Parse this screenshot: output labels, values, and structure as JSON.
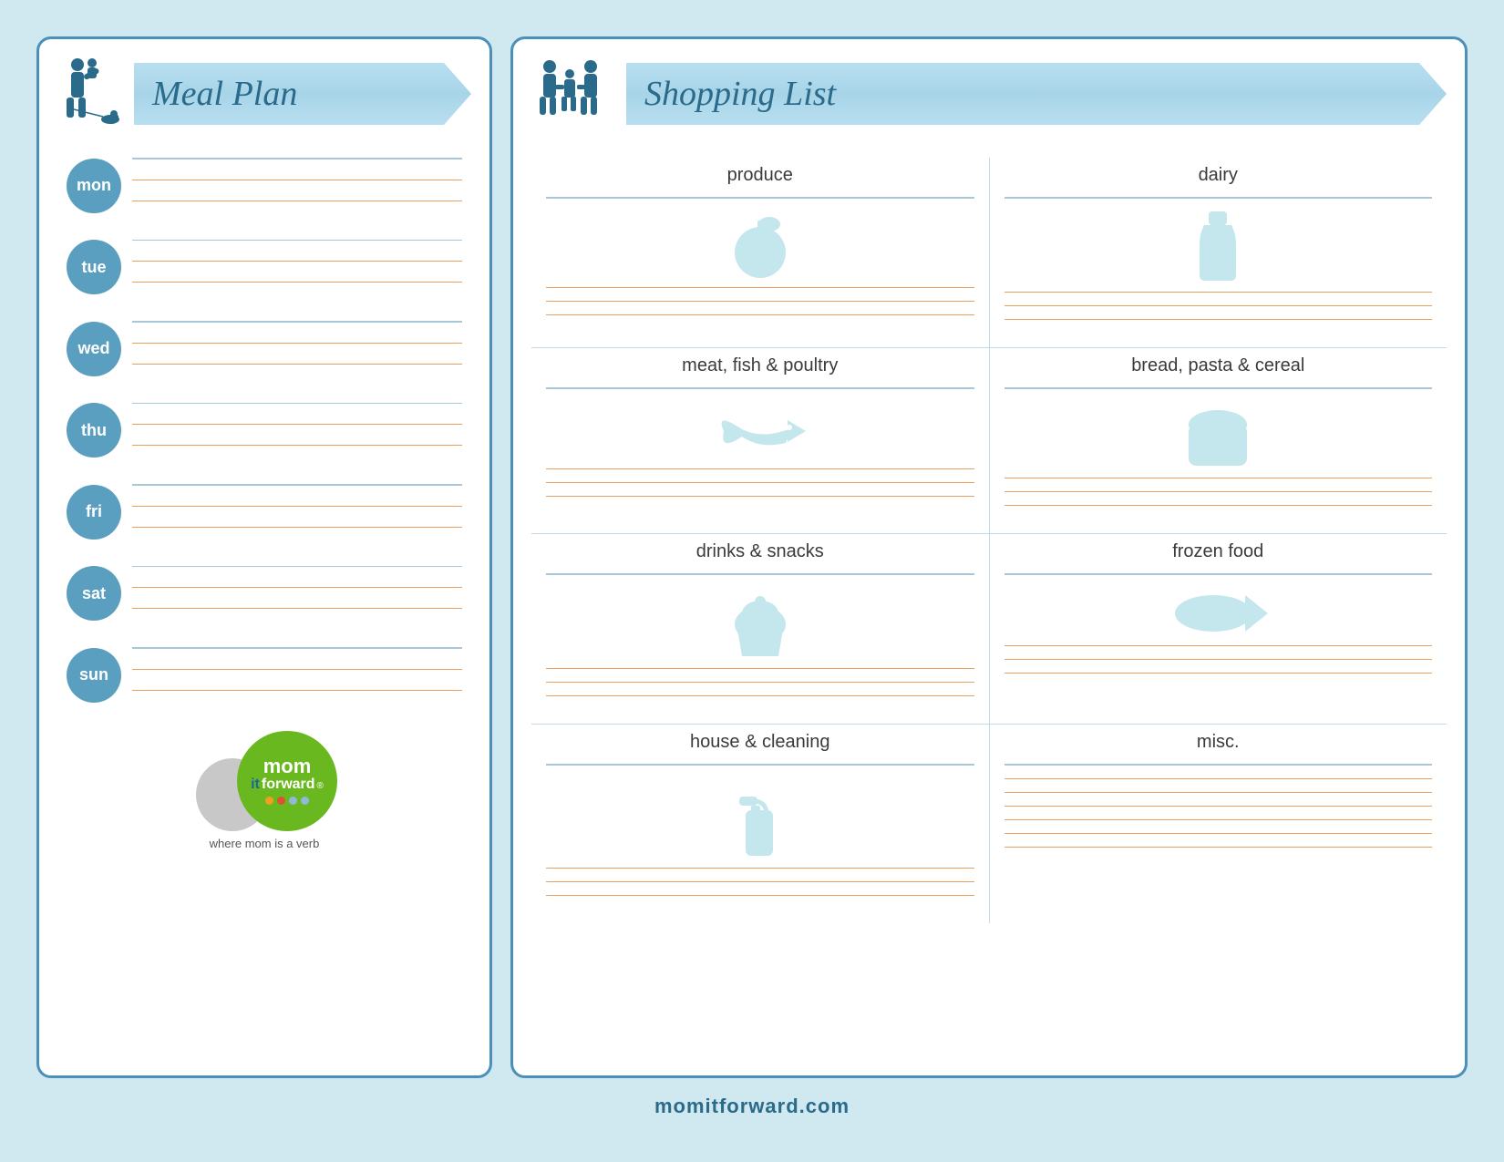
{
  "page": {
    "background": "#cde8f2",
    "footer_text": "momitforward.com"
  },
  "meal_plan": {
    "title": "Meal Plan",
    "days": [
      {
        "label": "mon",
        "id": "monday"
      },
      {
        "label": "tue",
        "id": "tuesday"
      },
      {
        "label": "wed",
        "id": "wednesday"
      },
      {
        "label": "thu",
        "id": "thursday"
      },
      {
        "label": "fri",
        "id": "friday"
      },
      {
        "label": "sat",
        "id": "saturday"
      },
      {
        "label": "sun",
        "id": "sunday"
      }
    ]
  },
  "shopping_list": {
    "title": "Shopping List",
    "sections": [
      {
        "id": "produce",
        "label": "produce",
        "col": "left",
        "row": 0
      },
      {
        "id": "dairy",
        "label": "dairy",
        "col": "right",
        "row": 0
      },
      {
        "id": "meat",
        "label": "meat, fish & poultry",
        "col": "left",
        "row": 1
      },
      {
        "id": "bread",
        "label": "bread, pasta & cereal",
        "col": "right",
        "row": 1
      },
      {
        "id": "drinks",
        "label": "drinks & snacks",
        "col": "left",
        "row": 2
      },
      {
        "id": "frozen",
        "label": "frozen food",
        "col": "right",
        "row": 2
      },
      {
        "id": "house",
        "label": "house & cleaning",
        "col": "left",
        "row": 3
      },
      {
        "id": "misc",
        "label": "misc.",
        "col": "right",
        "row": 3
      }
    ]
  },
  "logo": {
    "brand_top": "mom",
    "brand_it": "it",
    "brand_forward": "forward",
    "tagline": "where mom is a verb",
    "dots_colors": [
      "#f0a020",
      "#e05030",
      "#90b0e0",
      "#90b0e0"
    ]
  }
}
